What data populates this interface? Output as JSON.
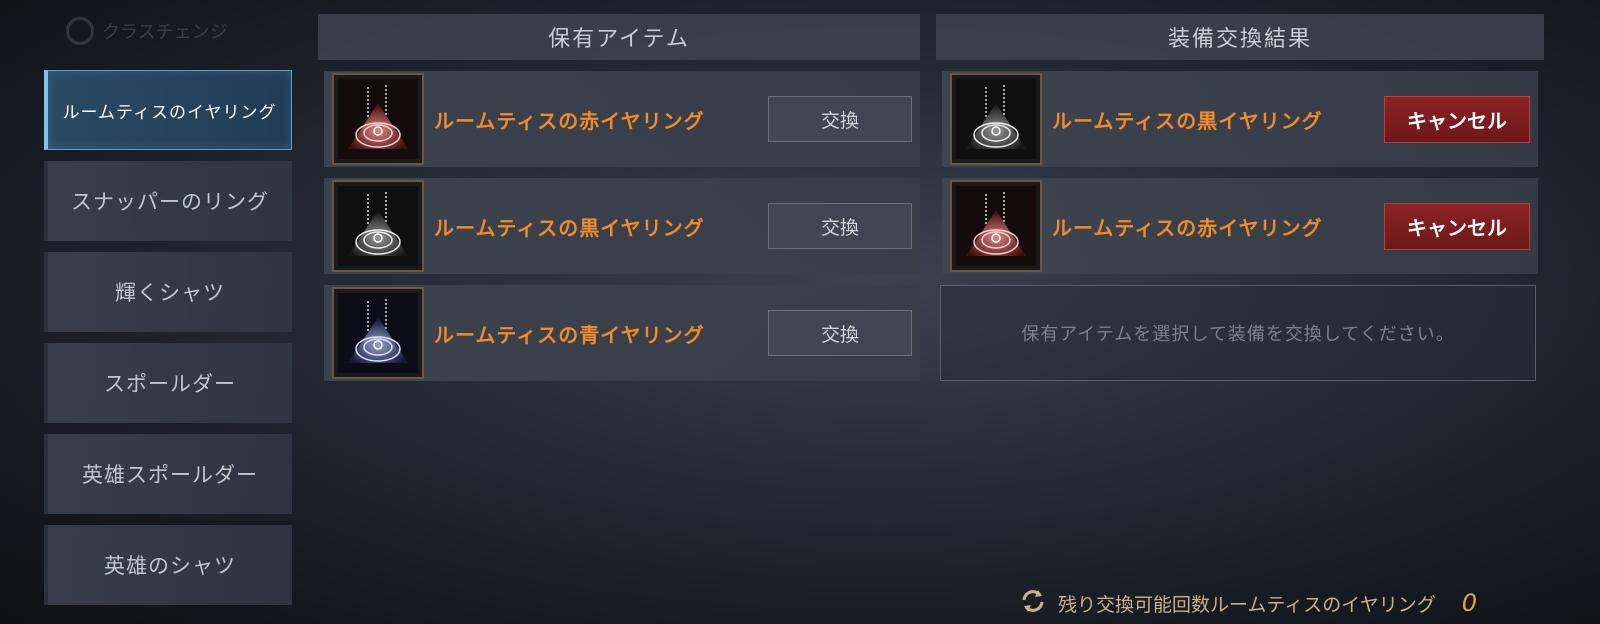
{
  "top_tab": {
    "label": "クラスチェンジ"
  },
  "sidebar": {
    "items": [
      {
        "label": "ルームティスのイヤリング",
        "active": true
      },
      {
        "label": "スナッパーのリング",
        "active": false
      },
      {
        "label": "輝くシャツ",
        "active": false
      },
      {
        "label": "スポールダー",
        "active": false
      },
      {
        "label": "英雄スポールダー",
        "active": false
      },
      {
        "label": "英雄のシャツ",
        "active": false
      }
    ]
  },
  "owned": {
    "header": "保有アイテム",
    "items": [
      {
        "name": "ルームティスの赤イヤリング",
        "icon": "red-earring-icon",
        "button": "交換"
      },
      {
        "name": "ルームティスの黒イヤリング",
        "icon": "black-earring-icon",
        "button": "交換"
      },
      {
        "name": "ルームティスの青イヤリング",
        "icon": "blue-earring-icon",
        "button": "交換"
      }
    ]
  },
  "result": {
    "header": "装備交換結果",
    "items": [
      {
        "name": "ルームティスの黒イヤリング",
        "icon": "black-earring-icon",
        "button": "キャンセル"
      },
      {
        "name": "ルームティスの赤イヤリング",
        "icon": "red-earring-icon",
        "button": "キャンセル"
      }
    ],
    "empty_message": "保有アイテムを選択して装備を交換してください。"
  },
  "footer": {
    "label": "残り交換可能回数ルームティスのイヤリング",
    "count": "0"
  },
  "colors": {
    "item_name": "#f08a2a",
    "cancel_bg": "#8c2224",
    "active_tab": "#7cc4ee",
    "red_gem": "#ff6a6a",
    "blue_gem": "#8aa8ff",
    "black_gem": "#e8e8e8"
  }
}
